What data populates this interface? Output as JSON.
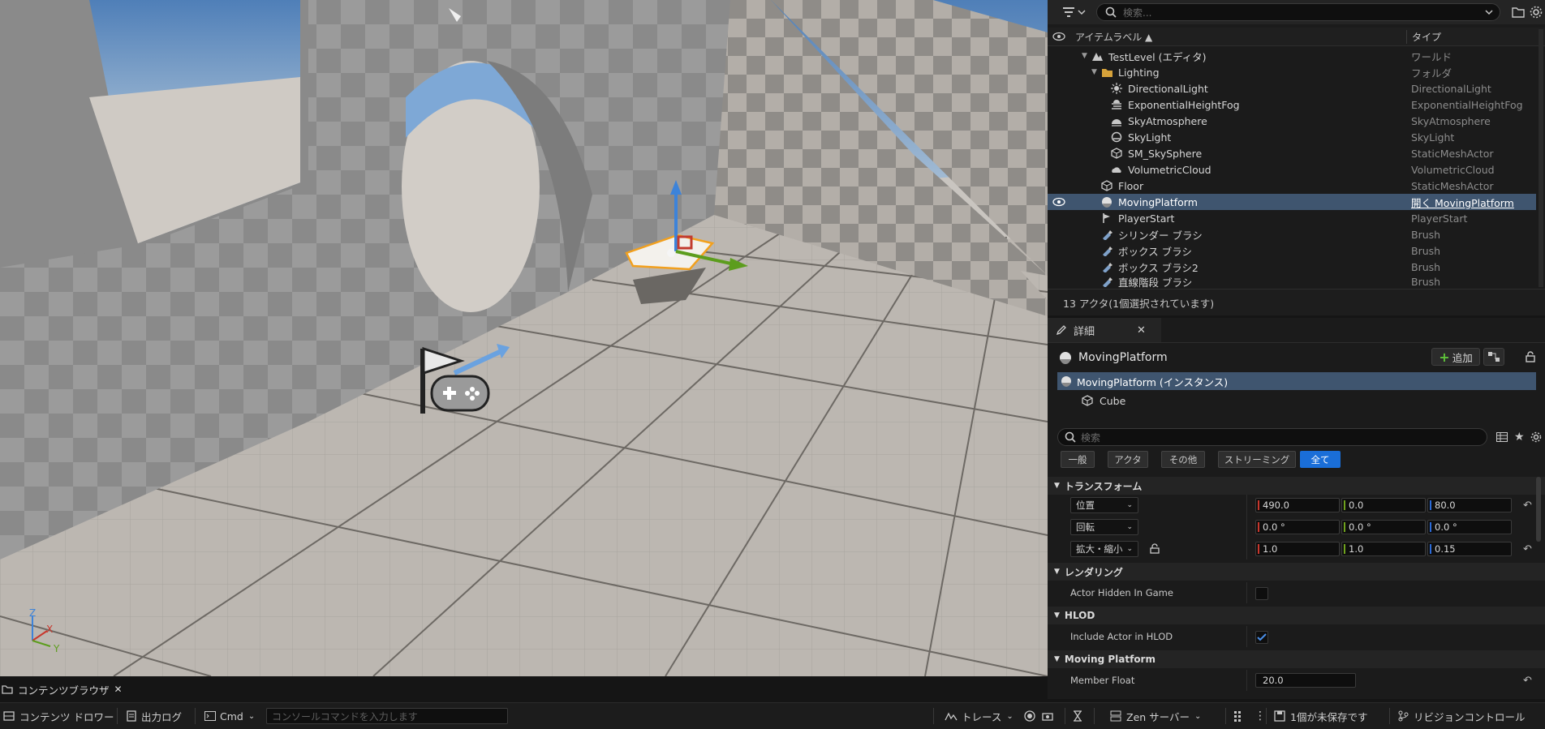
{
  "outliner": {
    "search_placeholder": "検索...",
    "col_label": "アイテムラベル ▲",
    "col_type": "タイプ",
    "rows": [
      {
        "label": "TestLevel (エディタ)",
        "type": "ワールド"
      },
      {
        "label": "Lighting",
        "type": "フォルダ"
      },
      {
        "label": "DirectionalLight",
        "type": "DirectionalLight"
      },
      {
        "label": "ExponentialHeightFog",
        "type": "ExponentialHeightFog"
      },
      {
        "label": "SkyAtmosphere",
        "type": "SkyAtmosphere"
      },
      {
        "label": "SkyLight",
        "type": "SkyLight"
      },
      {
        "label": "SM_SkySphere",
        "type": "StaticMeshActor"
      },
      {
        "label": "VolumetricCloud",
        "type": "VolumetricCloud"
      },
      {
        "label": "Floor",
        "type": "StaticMeshActor"
      },
      {
        "label": "MovingPlatform",
        "type": "開く MovingPlatform"
      },
      {
        "label": "PlayerStart",
        "type": "PlayerStart"
      },
      {
        "label": "シリンダー ブラシ",
        "type": "Brush"
      },
      {
        "label": "ボックス ブラシ",
        "type": "Brush"
      },
      {
        "label": "ボックス ブラシ2",
        "type": "Brush"
      },
      {
        "label": "直線階段 ブラシ",
        "type": "Brush"
      }
    ],
    "status": "13 アクタ(1個選択されています)"
  },
  "details": {
    "tab_label": "詳細",
    "actor_name": "MovingPlatform",
    "add_label": "追加",
    "instance_label": "MovingPlatform (インスタンス)",
    "component_label": "Cube",
    "search_placeholder": "検索",
    "filters": [
      "一般",
      "アクタ",
      "その他",
      "ストリーミング",
      "全て"
    ],
    "sections": {
      "transform": "トランスフォーム",
      "rendering": "レンダリング",
      "hlod": "HLOD",
      "moving": "Moving Platform"
    },
    "location": {
      "label": "位置",
      "x": "490.0",
      "y": "0.0",
      "z": "80.0"
    },
    "rotation": {
      "label": "回転",
      "x": "0.0 °",
      "y": "0.0 °",
      "z": "0.0 °"
    },
    "scale": {
      "label": "拡大・縮小",
      "x": "1.0",
      "y": "1.0",
      "z": "0.15"
    },
    "actor_hidden_label": "Actor Hidden In Game",
    "actor_hidden": false,
    "include_hlod_label": "Include Actor in HLOD",
    "include_hlod": true,
    "member_float_label": "Member Float",
    "member_float": "20.0"
  },
  "viewport": {
    "axis_z": "Z",
    "axis_x": "X",
    "axis_y": "Y"
  },
  "bottom_tab": {
    "label": "コンテンツブラウザ"
  },
  "statusbar": {
    "content_drawer": "コンテンツ ドロワー",
    "output_log": "出力ログ",
    "cmd": "Cmd",
    "console_placeholder": "コンソールコマンドを入力します",
    "trace": "トレース",
    "zen_server": "Zen サーバー",
    "unsaved": "1個が未保存です",
    "revision_control": "リビジョンコントロール"
  },
  "colors": {
    "selection": "#3f556f",
    "accent_blue": "#1a6ed8",
    "add_green": "#5fc33a"
  }
}
